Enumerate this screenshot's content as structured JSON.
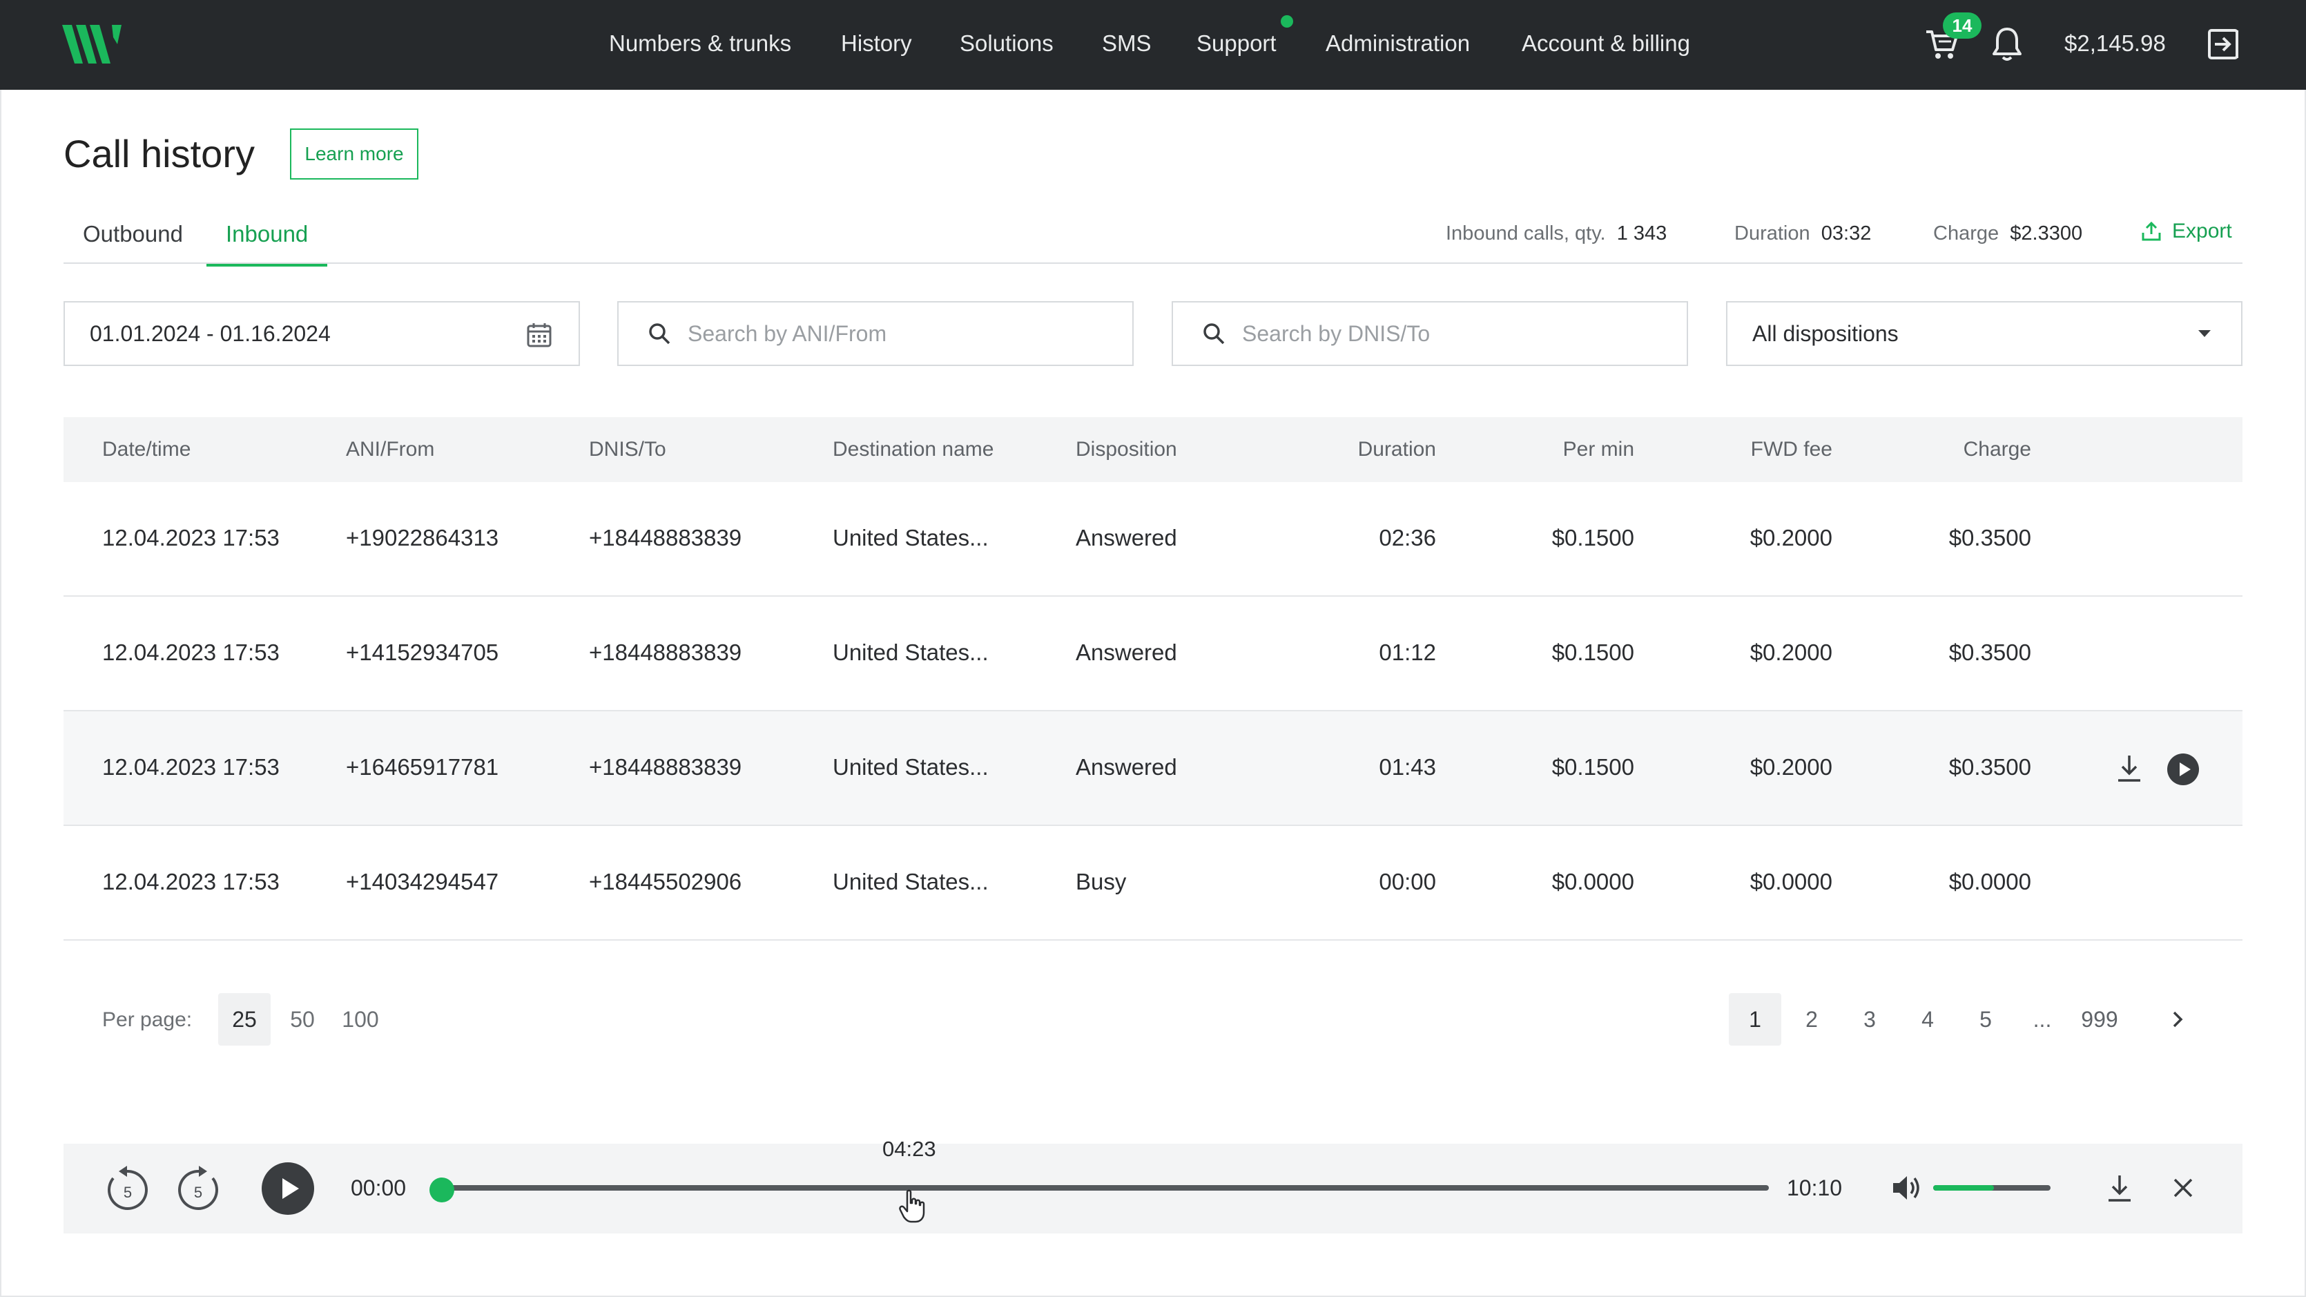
{
  "nav": {
    "items": [
      "Numbers & trunks",
      "History",
      "Solutions",
      "SMS",
      "Support",
      "Administration",
      "Account & billing"
    ],
    "cart_count": "14",
    "balance": "$2,145.98"
  },
  "page": {
    "title": "Call history",
    "learn_more": "Learn more"
  },
  "tabs": [
    "Outbound",
    "Inbound"
  ],
  "active_tab": "Inbound",
  "summary": {
    "calls_label": "Inbound calls, qty.",
    "calls_value": "1 343",
    "duration_label": "Duration",
    "duration_value": "03:32",
    "charge_label": "Charge",
    "charge_value": "$2.3300",
    "export_label": "Export"
  },
  "filters": {
    "date_range": "01.01.2024 - 01.16.2024",
    "ani_placeholder": "Search by ANI/From",
    "dnis_placeholder": "Search by DNIS/To",
    "disposition": "All dispositions"
  },
  "table": {
    "columns": [
      "Date/time",
      "ANI/From",
      "DNIS/To",
      "Destination name",
      "Disposition",
      "Duration",
      "Per min",
      "FWD fee",
      "Charge"
    ],
    "rows": [
      [
        "12.04.2023 17:53",
        "+19022864313",
        "+18448883839",
        "United States...",
        "Answered",
        "02:36",
        "$0.1500",
        "$0.2000",
        "$0.3500"
      ],
      [
        "12.04.2023 17:53",
        "+14152934705",
        "+18448883839",
        "United States...",
        "Answered",
        "01:12",
        "$0.1500",
        "$0.2000",
        "$0.3500"
      ],
      [
        "12.04.2023 17:53",
        "+16465917781",
        "+18448883839",
        "United States...",
        "Answered",
        "01:43",
        "$0.1500",
        "$0.2000",
        "$0.3500"
      ],
      [
        "12.04.2023 17:53",
        "+14034294547",
        "+18445502906",
        "United States...",
        "Busy",
        "00:00",
        "$0.0000",
        "$0.0000",
        "$0.0000"
      ]
    ]
  },
  "pagination": {
    "per_page_label": "Per page:",
    "per_page_options": [
      "25",
      "50",
      "100"
    ],
    "per_page_selected": "25",
    "pages": [
      "1",
      "2",
      "3",
      "4",
      "5",
      "...",
      "999"
    ],
    "current_page": "1"
  },
  "player": {
    "hover_time": "04:23",
    "current_time": "00:00",
    "total_time": "10:10",
    "rewind_seconds": "5",
    "forward_seconds": "5",
    "progress": 0,
    "volume": 0.52
  },
  "colors": {
    "accent": "#1bb85c",
    "topbar": "#26292c"
  },
  "icons": [
    "logo",
    "cart-icon",
    "bell-icon",
    "logout-icon",
    "calendar-icon",
    "search-icon",
    "caret-down-icon",
    "export-icon",
    "download-icon",
    "play-icon",
    "rewind-icon",
    "forward-icon",
    "volume-icon",
    "close-icon",
    "chevron-right-icon",
    "cursor-hand-icon"
  ]
}
